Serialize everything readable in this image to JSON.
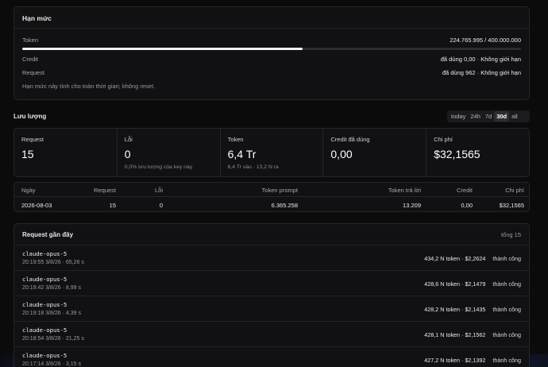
{
  "quota": {
    "title": "Hạn mức",
    "token_label": "Token",
    "token_value": "224.765.995 / 400.000.000",
    "token_used_fraction": 0.5619,
    "credit_label": "Credit",
    "credit_value": "đã dùng 0,00 · Không giới hạn",
    "request_label": "Request",
    "request_value": "đã dùng 962 · Không giới hạn",
    "note": "Hạn mức này tính cho toàn thời gian; không reset."
  },
  "traffic": {
    "title": "Lưu lượng",
    "ranges": [
      "today",
      "24h",
      "7d",
      "30d",
      "all"
    ],
    "active_range": "30d",
    "stats": [
      {
        "label": "Request",
        "value": "15",
        "sub": ""
      },
      {
        "label": "Lỗi",
        "value": "0",
        "sub": "0,0% lưu lượng của key này"
      },
      {
        "label": "Token",
        "value": "6,4 Tr",
        "sub": "6,4 Tr vào · 13,2 N ra"
      },
      {
        "label": "Credit đã dùng",
        "value": "0,00",
        "sub": ""
      },
      {
        "label": "Chi phí",
        "value": "$32,1565",
        "sub": ""
      }
    ]
  },
  "daily_table": {
    "headers": {
      "date": "Ngày",
      "request": "Request",
      "errors": "Lỗi",
      "token_prompt": "Token prompt",
      "token_reply": "Token trả lời",
      "credit": "Credit",
      "cost": "Chi phí"
    },
    "rows": [
      {
        "date": "2026-08-03",
        "request": "15",
        "errors": "0",
        "token_prompt": "6.365.258",
        "token_reply": "13.209",
        "credit": "0,00",
        "cost": "$32,1565"
      }
    ]
  },
  "recent": {
    "title": "Request gần đây",
    "count": "tổng 15",
    "items": [
      {
        "model": "claude-opus-5",
        "meta": "20:19:55 3/8/26 · 65,26 s",
        "tokens": "434,2 N token · $2,2624",
        "status": "thành công"
      },
      {
        "model": "claude-opus-5",
        "meta": "20:19:42 3/8/26 · 8,99 s",
        "tokens": "428,6 N token · $2,1479",
        "status": "thành công"
      },
      {
        "model": "claude-opus-5",
        "meta": "20:19:18 3/8/26 · 4,39 s",
        "tokens": "428,2 N token · $2,1435",
        "status": "thành công"
      },
      {
        "model": "claude-opus-5",
        "meta": "20:18:54 3/8/26 · 21,25 s",
        "tokens": "428,1 N token · $2,1562",
        "status": "thành công"
      },
      {
        "model": "claude-opus-5",
        "meta": "20:17:14 3/8/26 · 3,15 s",
        "tokens": "427,2 N token · $2,1392",
        "status": "thành công"
      }
    ]
  }
}
